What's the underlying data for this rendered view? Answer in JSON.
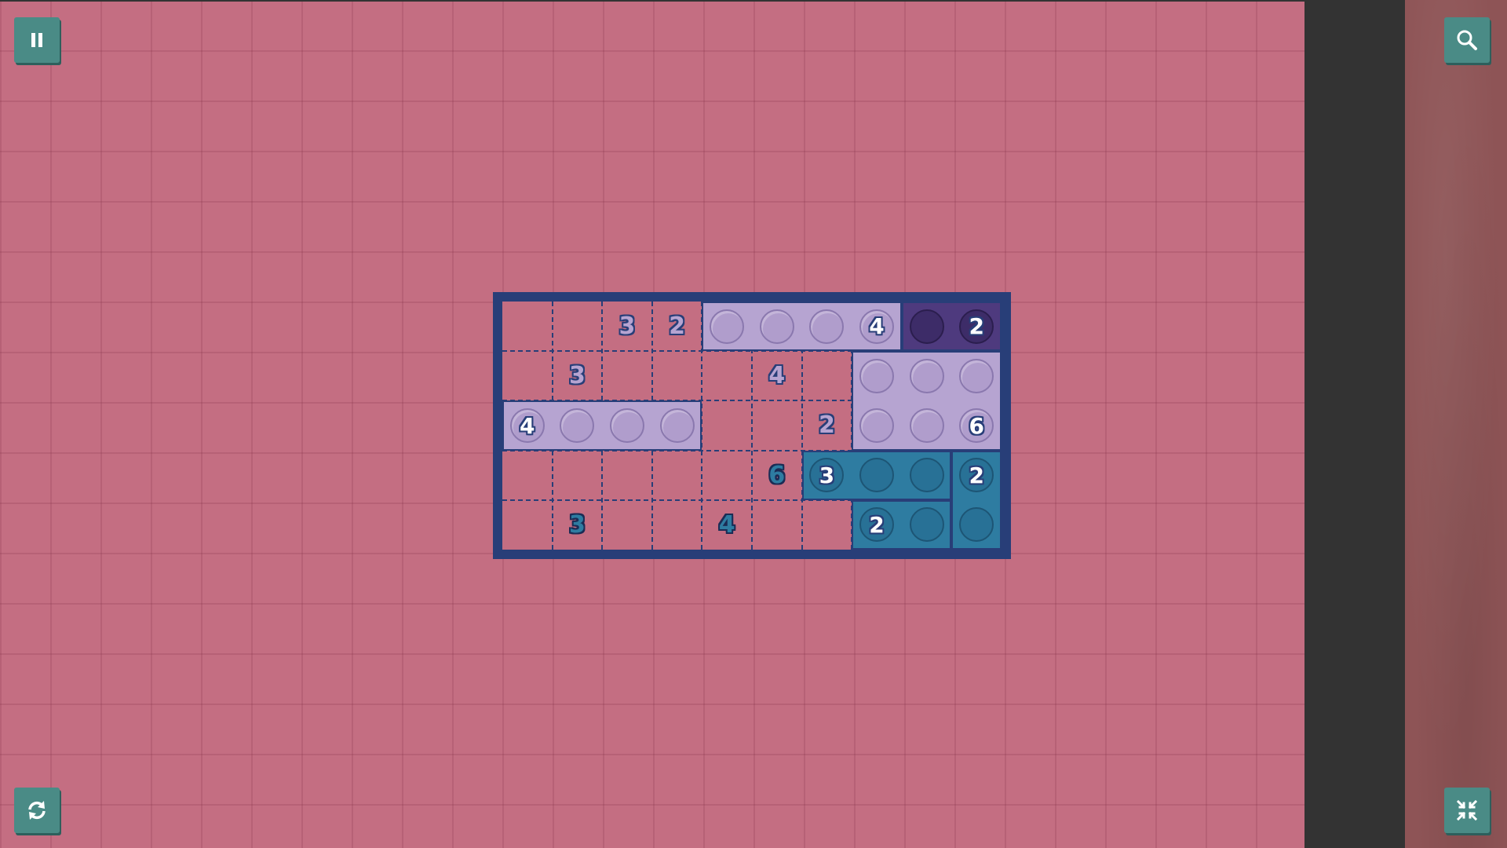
{
  "controls": {
    "pause": {
      "icon": "pause-icon"
    },
    "zoom": {
      "icon": "magnifier-icon"
    },
    "restart": {
      "icon": "restart-icon"
    },
    "collapse": {
      "icon": "collapse-icon"
    }
  },
  "colors": {
    "background": "#c46e82",
    "board_border": "#283e78",
    "lavender": "#b6a4d1",
    "purple": "#4e3a7e",
    "teal": "#2e7ca1",
    "button": "#4a8b86"
  },
  "puzzle": {
    "rows": 5,
    "cols": 10,
    "regions": [
      {
        "color": "lav",
        "cells": [
          [
            0,
            4
          ],
          [
            0,
            5
          ],
          [
            0,
            6
          ],
          [
            0,
            7
          ]
        ],
        "number": "4",
        "number_cell": [
          0,
          7
        ]
      },
      {
        "color": "pur",
        "cells": [
          [
            0,
            8
          ],
          [
            0,
            9
          ]
        ],
        "number": "2",
        "number_cell": [
          0,
          9
        ]
      },
      {
        "color": "lav",
        "cells": [
          [
            1,
            7
          ],
          [
            1,
            8
          ],
          [
            1,
            9
          ],
          [
            2,
            7
          ],
          [
            2,
            8
          ],
          [
            2,
            9
          ]
        ],
        "number": "6",
        "number_cell": [
          2,
          9
        ]
      },
      {
        "color": "lav",
        "cells": [
          [
            2,
            0
          ],
          [
            2,
            1
          ],
          [
            2,
            2
          ],
          [
            2,
            3
          ]
        ],
        "number": "4",
        "number_cell": [
          2,
          0
        ]
      },
      {
        "color": "teal",
        "cells": [
          [
            3,
            6
          ],
          [
            3,
            7
          ],
          [
            3,
            8
          ]
        ],
        "number": "3",
        "number_cell": [
          3,
          6
        ]
      },
      {
        "color": "teal",
        "cells": [
          [
            3,
            9
          ],
          [
            4,
            9
          ]
        ],
        "number": "2",
        "number_cell": [
          3,
          9
        ]
      },
      {
        "color": "teal",
        "cells": [
          [
            4,
            7
          ],
          [
            4,
            8
          ]
        ],
        "number": "2",
        "number_cell": [
          4,
          7
        ]
      }
    ],
    "clues": [
      {
        "cell": [
          0,
          2
        ],
        "value": "3",
        "color": "lav"
      },
      {
        "cell": [
          0,
          3
        ],
        "value": "2",
        "color": "lav"
      },
      {
        "cell": [
          1,
          1
        ],
        "value": "3",
        "color": "lav"
      },
      {
        "cell": [
          1,
          5
        ],
        "value": "4",
        "color": "lav"
      },
      {
        "cell": [
          2,
          6
        ],
        "value": "2",
        "color": "lav"
      },
      {
        "cell": [
          3,
          5
        ],
        "value": "6",
        "color": "teal"
      },
      {
        "cell": [
          4,
          1
        ],
        "value": "3",
        "color": "teal"
      },
      {
        "cell": [
          4,
          4
        ],
        "value": "4",
        "color": "teal"
      }
    ]
  }
}
